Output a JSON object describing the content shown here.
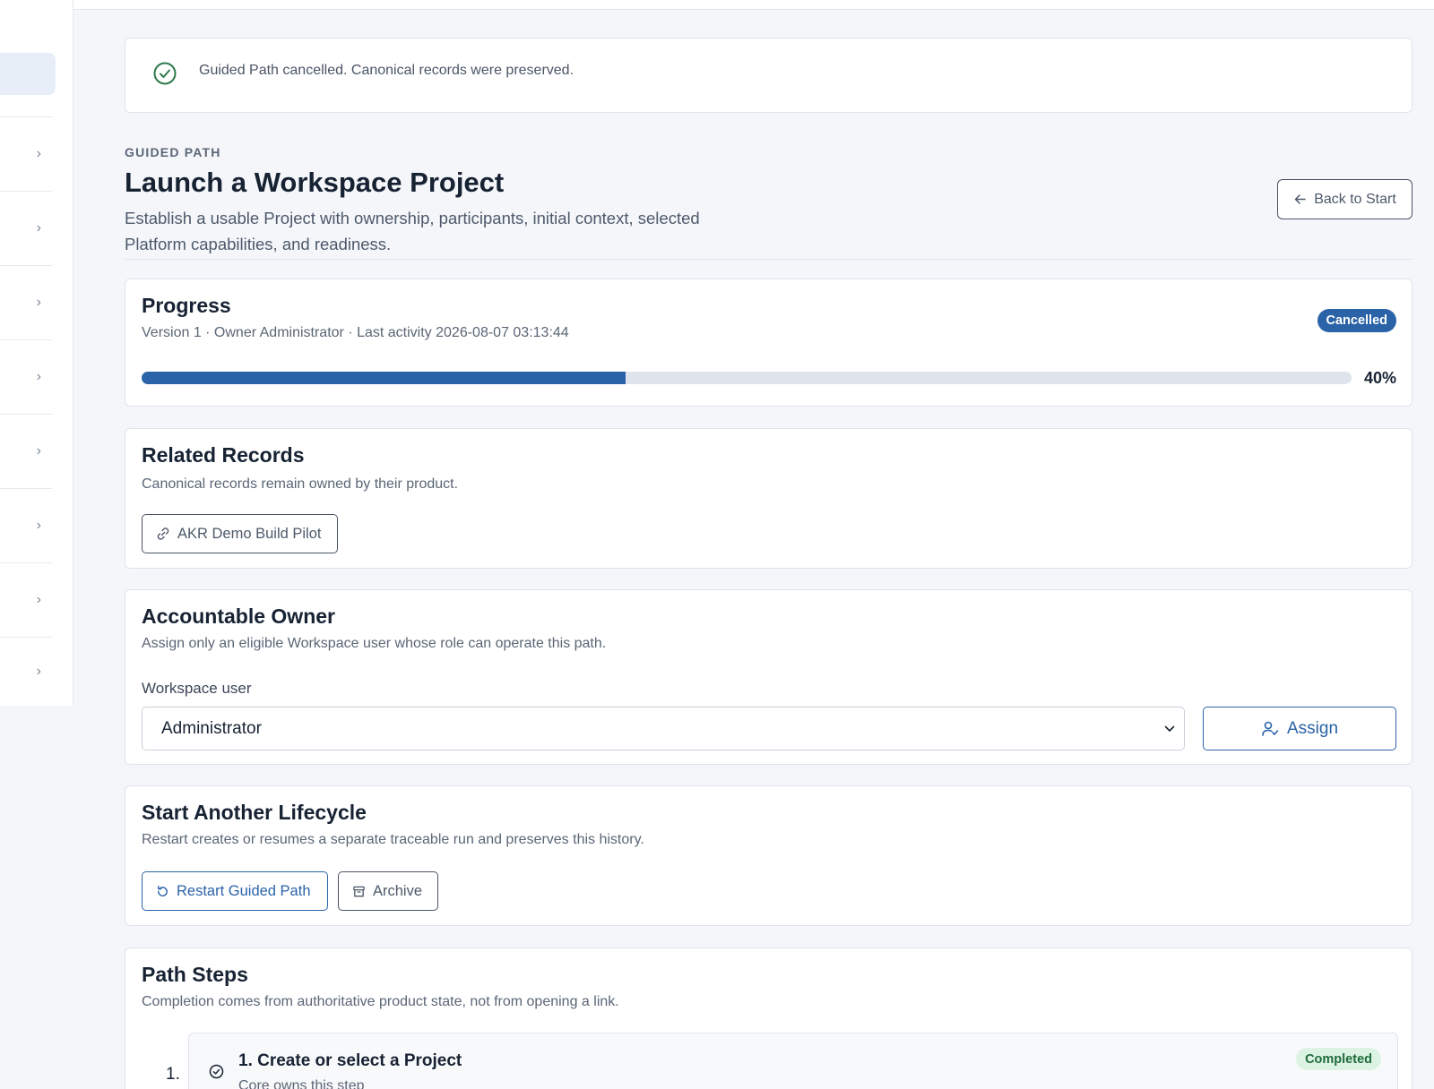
{
  "notice": {
    "message": "Guided Path cancelled. Canonical records were preserved."
  },
  "header": {
    "eyebrow": "GUIDED PATH",
    "title": "Launch a Workspace Project",
    "description": "Establish a usable Project with ownership, participants, initial context, selected Platform capabilities, and readiness.",
    "back_label": "Back to Start"
  },
  "progress": {
    "title": "Progress",
    "meta": "Version 1 · Owner Administrator · Last activity 2026-08-07 03:13:44",
    "status": "Cancelled",
    "percent_label": "40%",
    "percent_value": 40
  },
  "records": {
    "title": "Related Records",
    "subtitle": "Canonical records remain owned by their product.",
    "link_label": "AKR Demo Build Pilot"
  },
  "owner": {
    "title": "Accountable Owner",
    "subtitle": "Assign only an eligible Workspace user whose role can operate this path.",
    "field_label": "Workspace user",
    "selected_user": "Administrator",
    "assign_label": "Assign"
  },
  "lifecycle": {
    "title": "Start Another Lifecycle",
    "subtitle": "Restart creates or resumes a separate traceable run and preserves this history.",
    "restart_label": "Restart Guided Path",
    "archive_label": "Archive"
  },
  "steps": {
    "title": "Path Steps",
    "subtitle": "Completion comes from authoritative product state, not from opening a link.",
    "items": [
      {
        "number": "1.",
        "title": "1. Create or select a Project",
        "subtitle": "Core owns this step",
        "status": "Completed"
      }
    ]
  },
  "colors": {
    "accent": "#2b63a8",
    "success": "#1f6b3a",
    "success_bg": "#dcf3e3"
  }
}
